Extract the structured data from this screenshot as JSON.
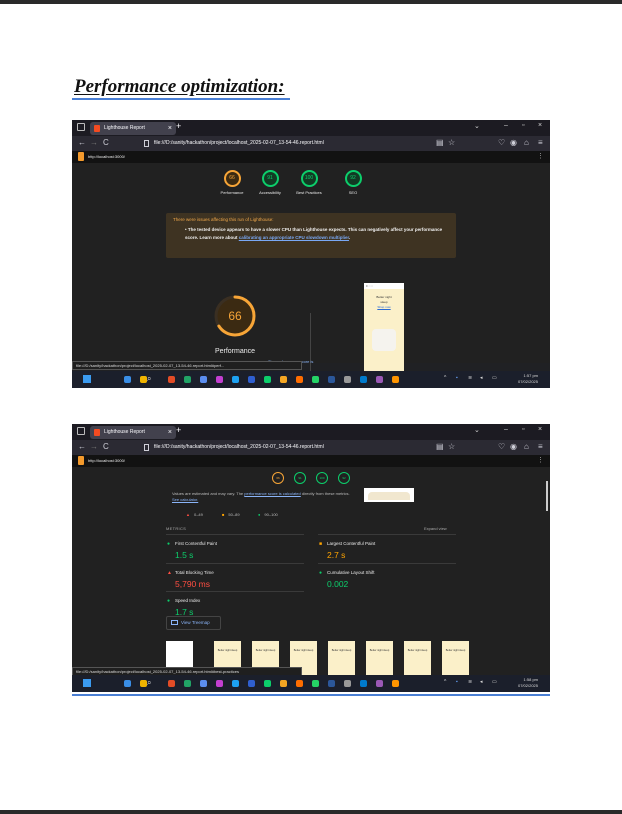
{
  "document": {
    "heading": "Performance optimization:"
  },
  "browser": {
    "tab_title": "Lighthouse Report",
    "tab_close": "×",
    "new_tab": "+",
    "url": "file:///D:/sanity/hackathon/project/localhost_2025-02-07_13-54-46.report.html",
    "back": "←",
    "forward": "→",
    "reload": "C",
    "minimize": "–",
    "maximize": "▫",
    "close": "×",
    "chevron": "⌄"
  },
  "lighthouse": {
    "site_url": "http://localhost:3000/",
    "menu": "⋮"
  },
  "shot1": {
    "gauges": [
      {
        "score": "66",
        "label": "Performance",
        "color": "#f7a537"
      },
      {
        "score": "91",
        "label": "Accessibility",
        "color": "#0cce6b"
      },
      {
        "score": "100",
        "label": "Best Practices",
        "color": "#0cce6b"
      },
      {
        "score": "92",
        "label": "SEO",
        "color": "#0cce6b"
      }
    ],
    "warning_title": "There were issues affecting this run of Lighthouse:",
    "warning_text_a": "The tested device appears to have a slower CPU than Lighthouse expects. This can negatively affect your performance score. Learn more about ",
    "warning_link": "calibrating an appropriate CPU slowdown multiplier",
    "warning_text_b": ".",
    "big_score": "66",
    "big_score_fraction": 0.66,
    "big_label": "Performance",
    "phone_title": "Better night",
    "phone_sub": "sleep",
    "phone_link": "Shop now",
    "tooltip_link": "The performance score is",
    "status_url": "file:///D:/sanity/hackathon/project/localhost_2025-02-07_13-54-46.report.html#perf..."
  },
  "shot2": {
    "mini_gauges": [
      {
        "score": "66",
        "color": "#f7a537"
      },
      {
        "score": "91",
        "color": "#0cce6b"
      },
      {
        "score": "100",
        "color": "#0cce6b"
      },
      {
        "score": "92",
        "color": "#0cce6b"
      }
    ],
    "note_a": "Values are estimated and may vary. The ",
    "note_link1": "performance score is calculated",
    "note_b": " directly from these metrics. ",
    "note_link2": "See calculator.",
    "legend": [
      {
        "mark": "▲",
        "range": "0–49",
        "color": "#ff4e42"
      },
      {
        "mark": "■",
        "range": "50–89",
        "color": "#ffa400"
      },
      {
        "mark": "●",
        "range": "90–100",
        "color": "#0cce6b"
      }
    ],
    "metrics_head": "METRICS",
    "expand": "Expand view",
    "metrics": [
      {
        "name": "First Contentful Paint",
        "value": "1.5 s",
        "mark": "●",
        "color": "#0cce6b"
      },
      {
        "name": "Largest Contentful Paint",
        "value": "2.7 s",
        "mark": "■",
        "color": "#ffa400"
      },
      {
        "name": "Total Blocking Time",
        "value": "5,790 ms",
        "mark": "▲",
        "color": "#ff4e42"
      },
      {
        "name": "Cumulative Layout Shift",
        "value": "0.002",
        "mark": "●",
        "color": "#0cce6b"
      },
      {
        "name": "Speed Index",
        "value": "1.7 s",
        "mark": "●",
        "color": "#0cce6b"
      }
    ],
    "treemap": "View Treemap",
    "frame_text": "Better night sleep",
    "status_url": "file:///D:/sanity/hackathon/project/localhost_2025-02-07_13-54-46.report.html#best-practices"
  },
  "taskbar": {
    "search_icon": "⌕",
    "tray": "^",
    "shot1_time": "1:57 pm",
    "shot1_date": "07/02/2025",
    "shot2_time": "1:58 pm",
    "shot2_date": "07/02/2025"
  }
}
